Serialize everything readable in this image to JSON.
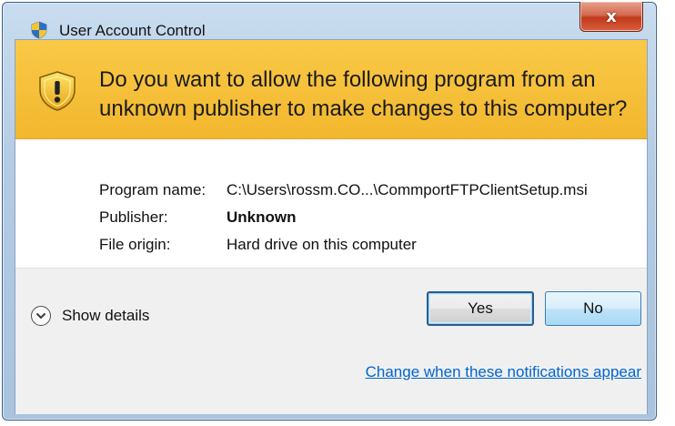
{
  "window": {
    "title": "User Account Control",
    "close_glyph": "x"
  },
  "banner": {
    "icon": "shield-warning-icon",
    "question": "Do you want to allow the following program from an unknown publisher to make changes to this computer?"
  },
  "info": {
    "program_name_label": "Program name:",
    "program_name_value": "C:\\Users\\rossm.CO...\\CommportFTPClientSetup.msi",
    "publisher_label": "Publisher:",
    "publisher_value": "Unknown",
    "file_origin_label": "File origin:",
    "file_origin_value": "Hard drive on this computer"
  },
  "footer": {
    "show_details_label": "Show details",
    "yes_label": "Yes",
    "no_label": "No",
    "change_link": "Change when these notifications appear"
  },
  "colors": {
    "banner": "#f6c13c",
    "link": "#0066cc",
    "close": "#c9472a"
  }
}
